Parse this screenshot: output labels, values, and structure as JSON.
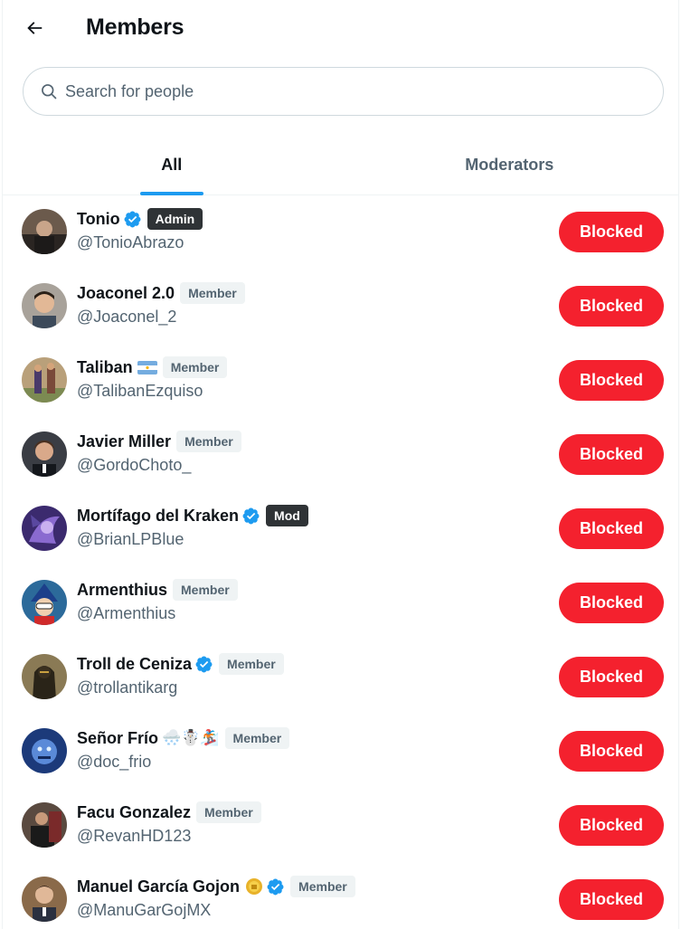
{
  "header": {
    "title": "Members"
  },
  "search": {
    "placeholder": "Search for people"
  },
  "tabs": [
    {
      "label": "All",
      "active": true
    },
    {
      "label": "Moderators",
      "active": false
    }
  ],
  "colors": {
    "accent": "#1d9bf0",
    "blocked": "#f4212e",
    "verified": "#1d9bf0"
  },
  "members": [
    {
      "name": "Tonio",
      "handle": "@TonioAbrazo",
      "verified": true,
      "badge": "Admin",
      "button": "Blocked",
      "emoji": ""
    },
    {
      "name": "Joaconel 2.0",
      "handle": "@Joaconel_2",
      "verified": false,
      "badge": "Member",
      "button": "Blocked",
      "emoji": ""
    },
    {
      "name": "Taliban",
      "handle": "@TalibanEzquiso",
      "verified": false,
      "badge": "Member",
      "button": "Blocked",
      "emoji": "argentina-flag-icon"
    },
    {
      "name": "Javier Miller",
      "handle": "@GordoChoto_",
      "verified": false,
      "badge": "Member",
      "button": "Blocked",
      "emoji": ""
    },
    {
      "name": "Mortífago del Kraken",
      "handle": "@BrianLPBlue",
      "verified": true,
      "badge": "Mod",
      "button": "Blocked",
      "emoji": ""
    },
    {
      "name": "Armenthius",
      "handle": "@Armenthius",
      "verified": false,
      "badge": "Member",
      "button": "Blocked",
      "emoji": ""
    },
    {
      "name": "Troll de Ceniza",
      "handle": "@trollantikarg",
      "verified": true,
      "badge": "Member",
      "button": "Blocked",
      "emoji": ""
    },
    {
      "name": "Señor Frío",
      "handle": "@doc_frio",
      "verified": false,
      "badge": "Member",
      "button": "Blocked",
      "emoji": "🌨️☃️🏂"
    },
    {
      "name": "Facu Gonzalez",
      "handle": "@RevanHD123",
      "verified": false,
      "badge": "Member",
      "button": "Blocked",
      "emoji": ""
    },
    {
      "name": "Manuel García Gojon",
      "handle": "@ManuGarGojMX",
      "verified": true,
      "badge": "Member",
      "button": "Blocked",
      "emoji": "gold-coin-icon"
    }
  ]
}
